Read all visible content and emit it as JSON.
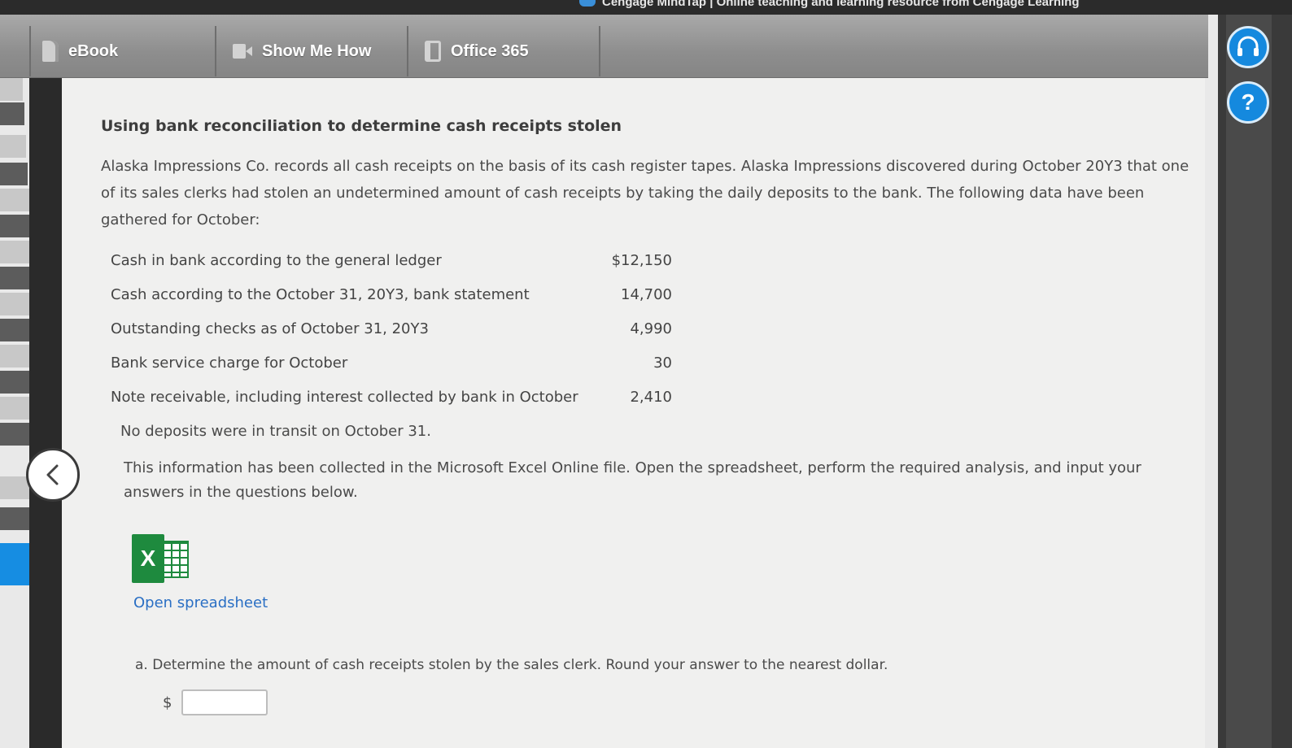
{
  "window": {
    "title": "Cengage MindTap | Online teaching and learning resource from Cengage Learning"
  },
  "toolbar": {
    "items": [
      {
        "label": "eBook",
        "icon": "book-icon"
      },
      {
        "label": "Show Me How",
        "icon": "video-icon"
      },
      {
        "label": "Office 365",
        "icon": "office-icon"
      }
    ]
  },
  "side_buttons": {
    "help_symbol": "?"
  },
  "problem": {
    "heading": "Using bank reconciliation to determine cash receipts stolen",
    "intro": "Alaska Impressions Co. records all cash receipts on the basis of its cash register tapes. Alaska Impressions discovered during October 20Y3 that one of its sales clerks had stolen an undetermined amount of cash receipts by taking the daily deposits to the bank. The following data have been gathered for October:",
    "data": [
      {
        "label": "Cash in bank according to the general ledger",
        "value": "$12,150"
      },
      {
        "label": "Cash according to the October 31, 20Y3, bank statement",
        "value": "14,700"
      },
      {
        "label": "Outstanding checks as of October 31, 20Y3",
        "value": "4,990"
      },
      {
        "label": "Bank service charge for October",
        "value": "30"
      },
      {
        "label": "Note receivable, including interest collected by bank in October",
        "value": "2,410"
      }
    ],
    "note": "No deposits were in transit on October 31.",
    "instructions": "This information has been collected in the Microsoft Excel Online file. Open the spreadsheet, perform the required analysis, and input your answers in the questions below.",
    "excel_icon_letter": "X",
    "open_link": "Open spreadsheet",
    "question_a": {
      "prefix": "a.",
      "text": "Determine the amount of cash receipts stolen by the sales clerk. Round your answer to the nearest dollar.",
      "currency": "$",
      "value": ""
    }
  }
}
